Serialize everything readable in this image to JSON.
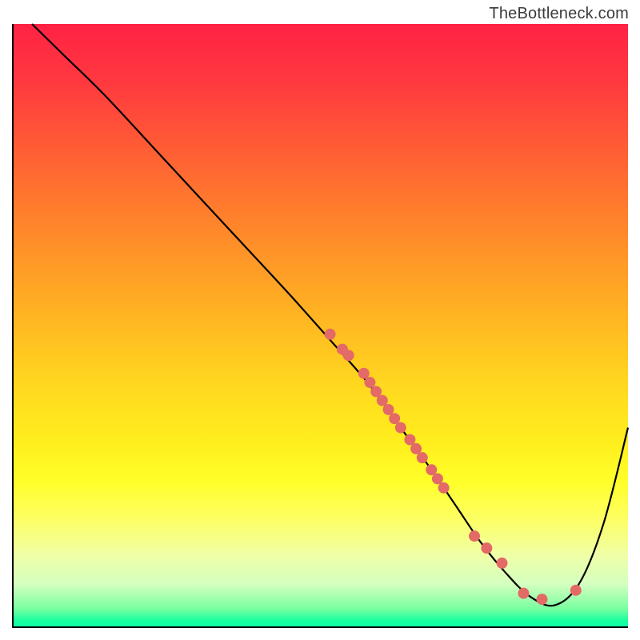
{
  "watermark": "TheBottleneck.com",
  "chart_data": {
    "type": "line",
    "title": "",
    "xlabel": "",
    "ylabel": "",
    "xlim": [
      0,
      100
    ],
    "ylim": [
      0,
      100
    ],
    "grid": false,
    "series": [
      {
        "name": "curve",
        "color": "#000000",
        "x": [
          3,
          8,
          15,
          25,
          35,
          45,
          52,
          58,
          63,
          68,
          72,
          76,
          80,
          84,
          88,
          92,
          96,
          100
        ],
        "y": [
          100,
          95,
          88,
          77,
          66,
          55,
          47,
          40,
          33,
          26,
          20,
          14,
          9,
          5,
          3.5,
          7,
          17,
          33
        ]
      }
    ],
    "marker_points": {
      "color": "#e36a66",
      "radius": 7,
      "x": [
        51.5,
        53.5,
        54.5,
        57,
        58,
        59,
        60,
        61,
        62,
        63,
        64.5,
        65.5,
        66.5,
        68,
        69,
        70,
        75,
        77,
        79.5,
        83,
        86,
        91.5
      ],
      "y": [
        48.5,
        46,
        45,
        42,
        40.5,
        39,
        37.5,
        36,
        34.5,
        33,
        31,
        29.5,
        28,
        26,
        24.5,
        23,
        15,
        13,
        10.5,
        5.5,
        4.5,
        6
      ]
    }
  }
}
